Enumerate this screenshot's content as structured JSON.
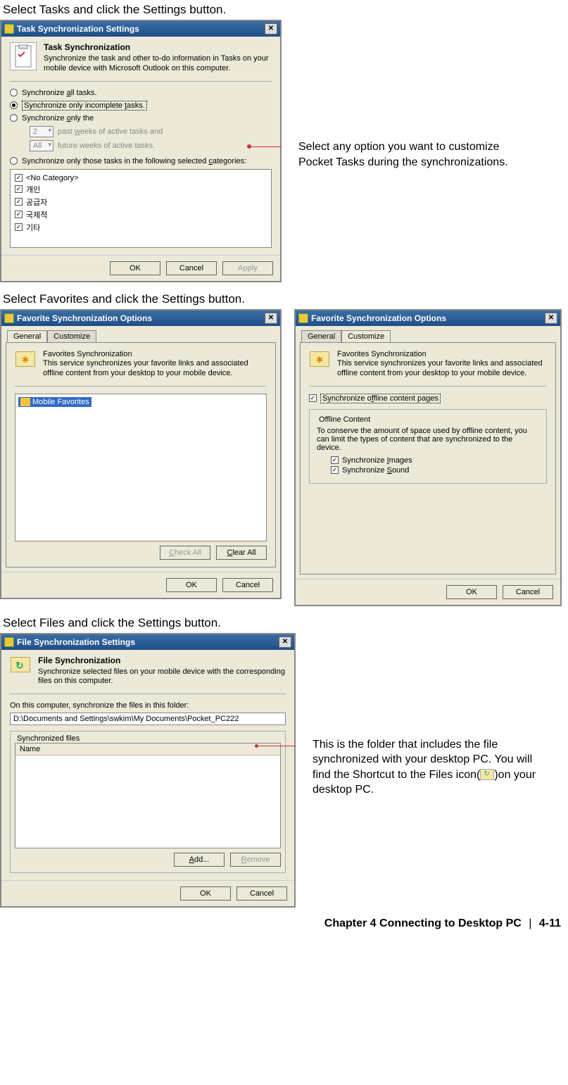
{
  "instr": {
    "tasks": "Select Tasks and click the Settings button.",
    "favorites": "Select Favorites and click the Settings button.",
    "files": "Select Files and click the Settings button."
  },
  "annot": {
    "tasks": "Select any option you want to customize Pocket Tasks during the synchronizations.",
    "files_a": "This is the folder that includes the file synchronized with your desktop PC. You will find the Shortcut to the Files icon(",
    "files_b": ")on your desktop PC."
  },
  "dlg_tasks": {
    "title": "Task Synchronization Settings",
    "htitle": "Task Synchronization",
    "hdesc": "Synchronize the task and other to-do information in Tasks on your mobile device with Microsoft Outlook on this computer.",
    "opt_all_a": "Synchronize ",
    "opt_all_u": "a",
    "opt_all_b": "ll tasks.",
    "opt_inc_a": "Synchronize only incomplete ",
    "opt_inc_u": "t",
    "opt_inc_b": "asks.",
    "opt_only_a": "Synchronize ",
    "opt_only_u": "o",
    "opt_only_b": "nly the",
    "combo_past": "2",
    "past_a": "past ",
    "past_u": "w",
    "past_b": "eeks of active tasks and",
    "combo_future": "All",
    "future_a": "future weeks of active tasks.",
    "opt_cat_a": "Synchronize only those tasks in the following selected ",
    "opt_cat_u": "c",
    "opt_cat_b": "ategories:",
    "cats": [
      "<No Category>",
      "개인",
      "공급자",
      "국제적",
      "기타"
    ],
    "ok": "OK",
    "cancel": "Cancel",
    "apply": "Apply"
  },
  "dlg_fav": {
    "title": "Favorite Synchronization Options",
    "tab_general": "General",
    "tab_customize": "Customize",
    "htitle": "Favorites Synchronization",
    "hdesc": "This service synchronizes your favorite links and associated offline content from your desktop to your mobile device.",
    "tree_item": "Mobile Favorites",
    "check_all": "Check All",
    "clear_all": "Clear All",
    "sync_off_a": "Synchronize o",
    "sync_off_u": "f",
    "sync_off_b": "fline content pages",
    "offline_legend": "Offline Content",
    "offline_desc": "To conserve the amount of space used by offline content, you can limit the types of content that are synchronized to the device.",
    "sync_img_a": "Synchronize ",
    "sync_img_u": "I",
    "sync_img_b": "mages",
    "sync_snd_a": "Synchronize ",
    "sync_snd_u": "S",
    "sync_snd_b": "ound",
    "ok": "OK",
    "cancel": "Cancel"
  },
  "dlg_files": {
    "title": "File Synchronization Settings",
    "htitle": "File Synchronization",
    "hdesc": "Synchronize selected files on your mobile device with the corresponding files on this computer.",
    "folder_label": "On this computer, synchronize the files in this folder:",
    "folder_path": "D:\\Documents and Settings\\swkim\\My Documents\\Pocket_PC222",
    "sync_legend": "Synchronized files",
    "col_name": "Name",
    "add": "Add...",
    "remove": "Remove",
    "ok": "OK",
    "cancel": "Cancel"
  },
  "footer": {
    "chapter": "Chapter 4   Connecting to Desktop PC",
    "sep": "|",
    "page": "4-11"
  }
}
